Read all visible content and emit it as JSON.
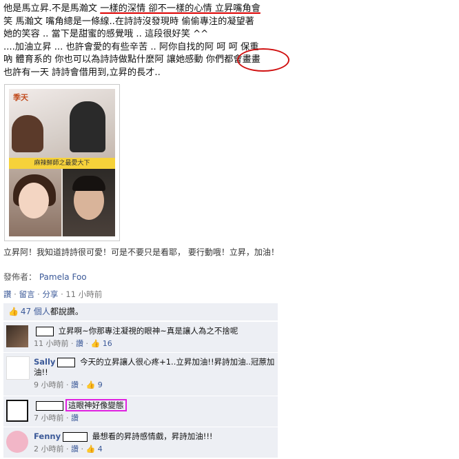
{
  "post": {
    "line1a": "他是馬立昇.不是馬瀚文 ",
    "line1b": "一樣的深情 卻不一樣的心情 立昇嘴角會",
    "line2": "笑 馬瀚文 嘴角總是一條線..在詩詩沒發現時 偷偷專注的凝望著",
    "line3": "她的笑容 .. 當下是甜蜜的感覺哦 .. 這段很好笑 ^^",
    "line4": "....加油立昇 ... 也許會愛的有些辛苦 .. 阿你自找的阿 呵 呵 保重",
    "line5": "吶 體育系的 你也可以為詩詩做點什麼阿 讓她感動 你們都會畫畫",
    "line6": "也許有一天 詩詩會借用到,立昇的長才.."
  },
  "photo": {
    "logo": "季天",
    "banner": "麻辣鮮師之最愛大下"
  },
  "caption": "立昇阿！我知道詩詩很可愛！可是不要只是看耶， 要行動哦！立昇，加油！",
  "poster": {
    "label": "發佈者：",
    "name": "Pamela Foo"
  },
  "actions": {
    "like": "讚",
    "comment": "留言",
    "share": "分享",
    "time": "11 小時前",
    "sep": "·"
  },
  "likes": {
    "icon": "thumbs-up-icon",
    "count_text": "47 個人",
    "suffix": "都說讚。"
  },
  "comments": [
    {
      "name": "",
      "text": "立昇啊~你那專注凝視的眼神~真是讓人為之不捨呢",
      "time": "11 小時前",
      "like": "讚",
      "likes": "16"
    },
    {
      "name": "Sally",
      "text": "今天的立昇讓人很心疼+1..立昇加油!!昇詩加油..冠蒝加油!!",
      "time": "9 小時前",
      "like": "讚",
      "likes": "9"
    },
    {
      "name": "",
      "text": "這眼神好像變態",
      "time": "7 小時前",
      "like": "讚",
      "likes": ""
    },
    {
      "name": "Fenny",
      "text": "最想看的昇詩感情戲，昇詩加油!!!",
      "time": "2 小時前",
      "like": "讚",
      "likes": "4"
    }
  ],
  "colors": {
    "link": "#3b5998",
    "annotation_red": "#d01010",
    "annotation_magenta": "#e020e0",
    "comment_bg": "#edeff4"
  }
}
